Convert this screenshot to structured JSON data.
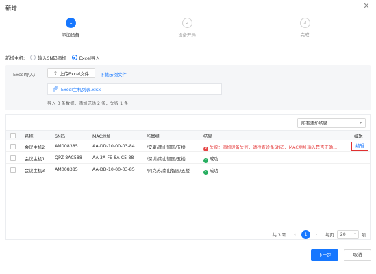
{
  "dialog": {
    "title": "新增",
    "close_icon": "close-icon"
  },
  "steps": [
    {
      "number": "1",
      "label": "添加设备",
      "state": "active"
    },
    {
      "number": "2",
      "label": "设备开局",
      "state": "todo"
    },
    {
      "number": "3",
      "label": "完成",
      "state": "todo"
    }
  ],
  "host": {
    "label": "新增主机:",
    "options": [
      {
        "label": "输入SN码添加",
        "checked": false
      },
      {
        "label": "Excel导入",
        "checked": true
      }
    ]
  },
  "excel": {
    "label": "Excel导入:",
    "upload_label": "上传Excel文件",
    "sample_link": "下载示例文件",
    "file_name": "Excel主机列表.xlsx",
    "summary": "导入 3 条数据，添加成功 2 条，失败 1 条"
  },
  "filter": {
    "value": "所有添加结果"
  },
  "table": {
    "headers": {
      "name": "名称",
      "sn": "SN码",
      "mac": "MAC地址",
      "group": "所属组",
      "result": "结果",
      "edit": "编辑"
    },
    "rows": [
      {
        "name": "会议主机2",
        "sn": "AM008385",
        "mac": "AA-DD-10-00-03-84",
        "group": "/安康/南山智园/五楼",
        "result": "失败：添加设备失败，请检查设备SN码、MAC地址输入是否正确...",
        "status": "fail",
        "edit": "编辑"
      },
      {
        "name": "会议主机1",
        "sn": "QPZ-8AC588",
        "mac": "AA-3A-FE-8A-C5-88",
        "group": "/深圳/南山智园/五楼",
        "result": "成功",
        "status": "ok",
        "edit": ""
      },
      {
        "name": "会议主机3",
        "sn": "AM008385",
        "mac": "AA-DD-10-00-03-85",
        "group": "/阿克苏/南山智园/五楼",
        "result": "成功",
        "status": "ok",
        "edit": ""
      }
    ]
  },
  "pager": {
    "total": "共 3 项",
    "page": "1",
    "per_page_label": "每页",
    "page_size": "20",
    "unit": "项"
  },
  "footer": {
    "next": "下一步",
    "cancel": "取消"
  },
  "colors": {
    "primary": "#1677ff",
    "error": "#e64545",
    "success": "#27ae60"
  }
}
